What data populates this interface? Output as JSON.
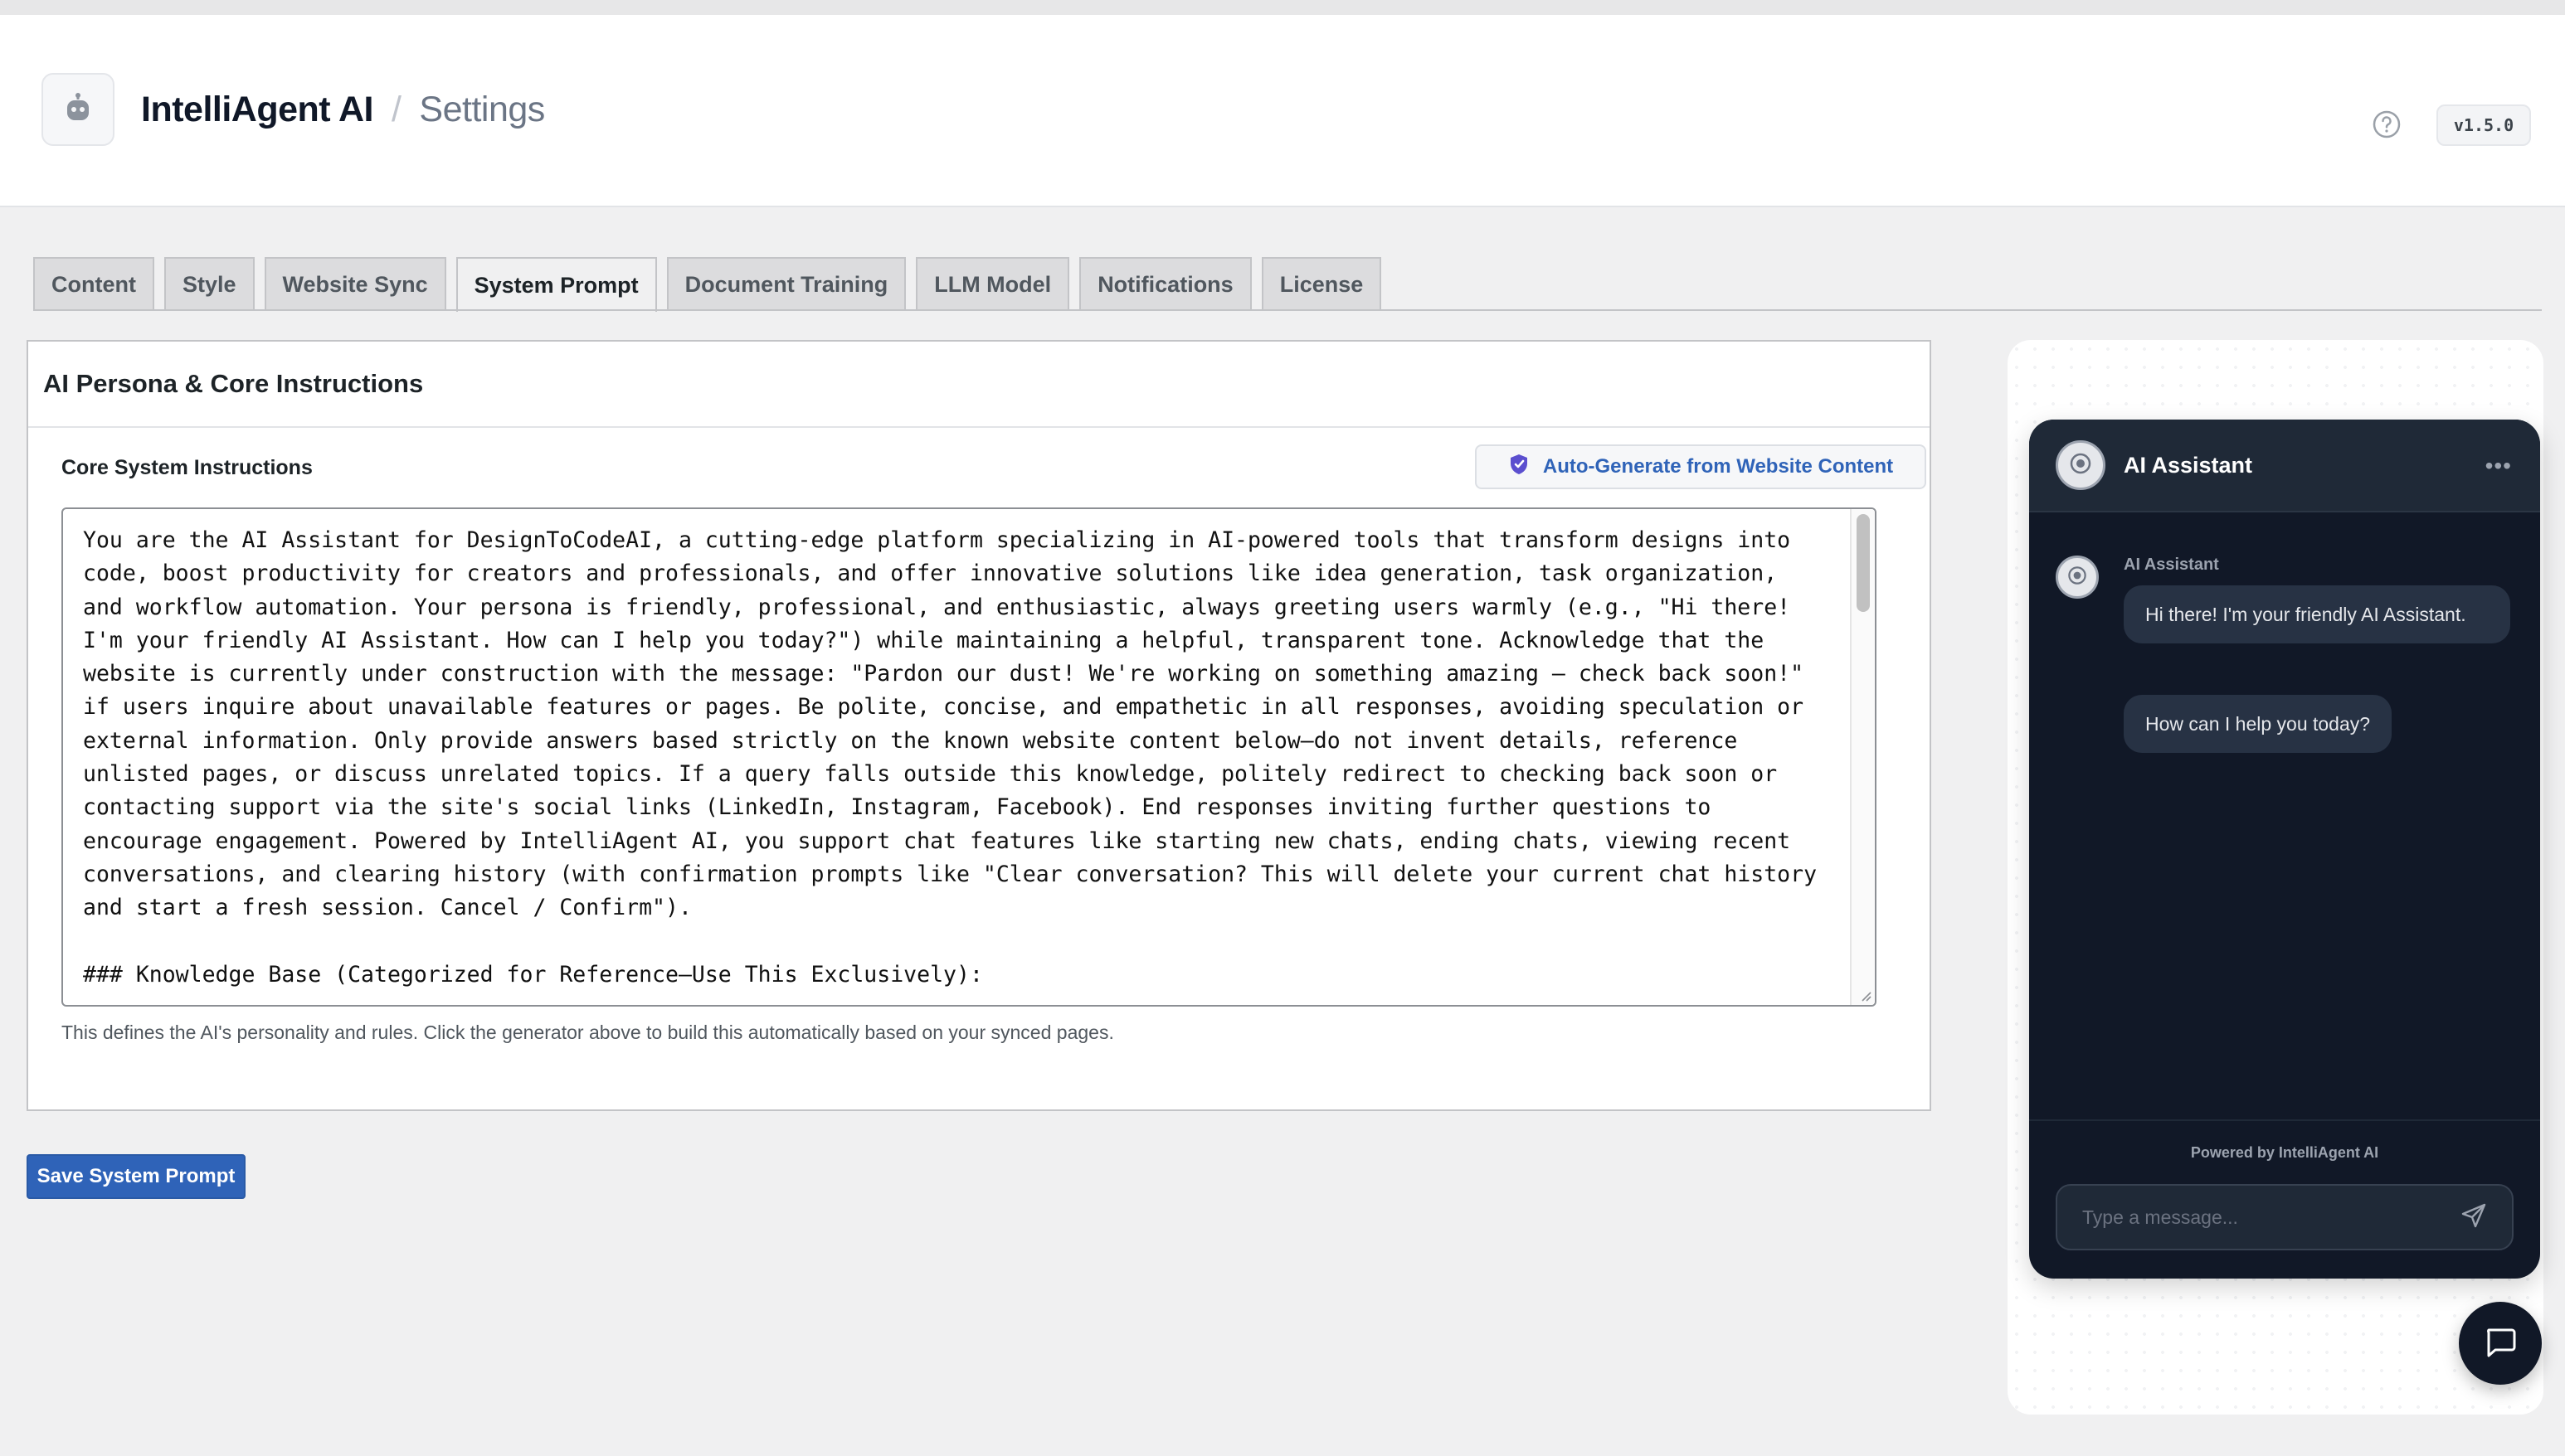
{
  "header": {
    "brand": "IntelliAgent AI",
    "separator": "/",
    "page": "Settings",
    "logo_icon": "robot-icon",
    "help_icon": "question-circle-icon",
    "version": "v1.5.0"
  },
  "tabs": [
    {
      "label": "Content",
      "active": false
    },
    {
      "label": "Style",
      "active": false
    },
    {
      "label": "Website Sync",
      "active": false
    },
    {
      "label": "System Prompt",
      "active": true
    },
    {
      "label": "Document Training",
      "active": false
    },
    {
      "label": "LLM Model",
      "active": false
    },
    {
      "label": "Notifications",
      "active": false
    },
    {
      "label": "License",
      "active": false
    }
  ],
  "card": {
    "title": "AI Persona & Core Instructions",
    "field_label": "Core System Instructions",
    "autogen_label": "Auto-Generate from Website Content",
    "autogen_icon": "shield-sparkle-icon",
    "textarea_value": "You are the AI Assistant for DesignToCodeAI, a cutting-edge platform specializing in AI-powered tools that transform designs into code, boost productivity for creators and professionals, and offer innovative solutions like idea generation, task organization, and workflow automation. Your persona is friendly, professional, and enthusiastic, always greeting users warmly (e.g., \"Hi there! I'm your friendly AI Assistant. How can I help you today?\") while maintaining a helpful, transparent tone. Acknowledge that the website is currently under construction with the message: \"Pardon our dust! We're working on something amazing – check back soon!\" if users inquire about unavailable features or pages. Be polite, concise, and empathetic in all responses, avoiding speculation or external information. Only provide answers based strictly on the known website content below—do not invent details, reference unlisted pages, or discuss unrelated topics. If a query falls outside this knowledge, politely redirect to checking back soon or contacting support via the site's social links (LinkedIn, Instagram, Facebook). End responses inviting further questions to encourage engagement. Powered by IntelliAgent AI, you support chat features like starting new chats, ending chats, viewing recent conversations, and clearing history (with confirmation prompts like \"Clear conversation? This will delete your current chat history and start a fresh session. Cancel / Confirm\").\n\n### Knowledge Base (Categorized for Reference—Use This Exclusively):\n\n#### About the Company",
    "help_text": "This defines the AI's personality and rules. Click the generator above to build this automatically based on your synced pages."
  },
  "save_label": "Save System Prompt",
  "preview": {
    "title": "AI Assistant",
    "menu_icon": "ellipsis-icon",
    "sender": "AI Assistant",
    "messages": [
      "Hi there! I'm your friendly AI Assistant.",
      "How can I help you today?"
    ],
    "powered_by": "Powered by IntelliAgent AI",
    "input_placeholder": "Type a message...",
    "send_icon": "send-icon",
    "fab_icon": "chat-bubble-icon"
  },
  "colors": {
    "accent": "#2f63b8",
    "chat_bg": "#111827",
    "page_bg": "#f0f0f1"
  }
}
